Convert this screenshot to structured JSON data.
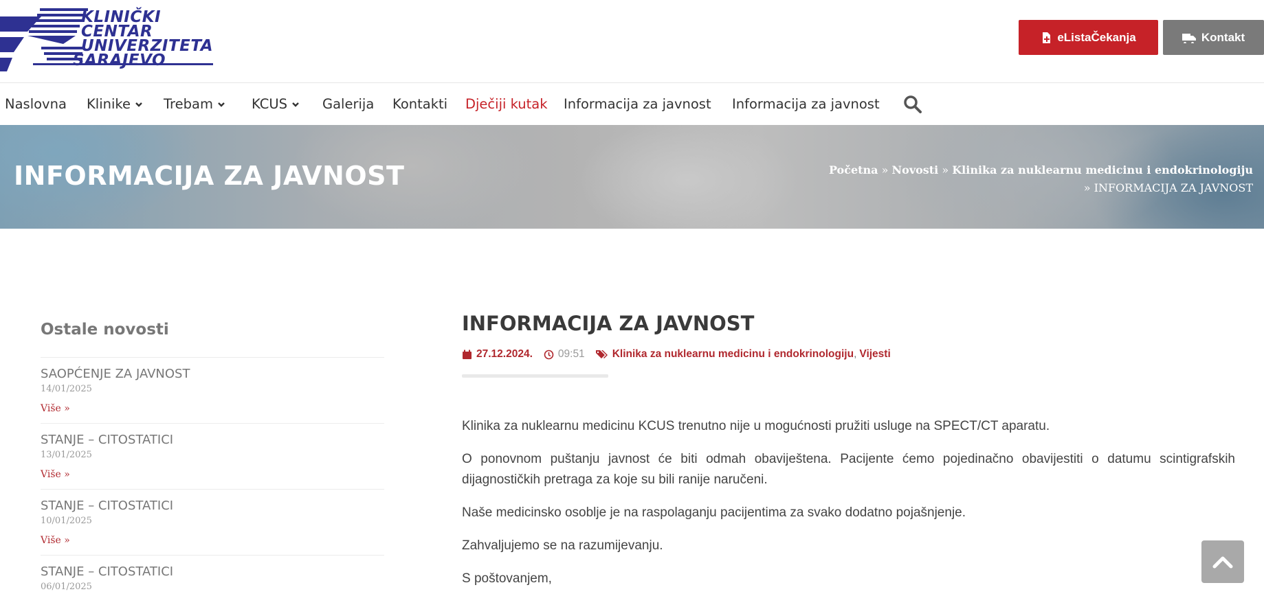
{
  "header": {
    "logo_lines": [
      "KLINIČKI",
      "CENTAR",
      "UNIVERZITETA",
      "SARAJEVO"
    ],
    "buttons": [
      {
        "label": "eListaČekanja",
        "icon": "file-plus-icon",
        "color": "#c62228"
      },
      {
        "label": "Kontakt",
        "icon": "ambulance-icon",
        "color": "#7a7a7a"
      }
    ],
    "brand_color": "#2e3192"
  },
  "nav": {
    "items": [
      {
        "label": "Naslovna"
      },
      {
        "label": "Klinike",
        "dropdown": true
      },
      {
        "label": "Trebam",
        "dropdown": true
      },
      {
        "label": "KCUS",
        "dropdown": true
      },
      {
        "label": "Galerija"
      },
      {
        "label": "Kontakti"
      },
      {
        "label": "Dječiji kutak",
        "highlight": "#c62228"
      },
      {
        "label": "Informacija za javnost"
      },
      {
        "label": "Informacija za javnost"
      }
    ],
    "search_icon": "search-icon"
  },
  "hero": {
    "title": "INFORMACIJA ZA JAVNOST",
    "breadcrumb": {
      "home": "Početna",
      "news": "Novosti",
      "category": "Klinika za nuklearnu medicinu i endokrinologiju",
      "current": "INFORMACIJA ZA JAVNOST",
      "separator": "»"
    }
  },
  "sidebar": {
    "title": "Ostale novosti",
    "more_label": "Više »",
    "items": [
      {
        "title": "SAOPĆENJE ZA JAVNOST",
        "date": "14/01/2025"
      },
      {
        "title": "STANJE – CITOSTATICI",
        "date": "13/01/2025"
      },
      {
        "title": "STANJE – CITOSTATICI",
        "date": "10/01/2025"
      },
      {
        "title": "STANJE – CITOSTATICI",
        "date": "06/01/2025"
      }
    ]
  },
  "article": {
    "title": "INFORMACIJA ZA JAVNOST",
    "date": "27.12.2024.",
    "time": "09:51",
    "categories": [
      "Klinika za nuklearnu medicinu i endokrinologiju",
      "Vijesti"
    ],
    "paragraphs": [
      "Klinika za nuklearnu medicinu KCUS trenutno nije u mogućnosti pružiti usluge na SPECT/CT aparatu.",
      "O ponovnom puštanju javnost će biti odmah obaviještena. Pacijente ćemo pojedinačno obavijestiti o datumu scintigrafskih dijagnostičkih pretraga za koje su bili ranije naručeni.",
      "Naše medicinsko osoblje je na raspolaganju pacijentima za svako dodatno pojašnjenje.",
      "Zahvaljujemo se na razumijevanju.",
      "S poštovanjem,"
    ]
  },
  "scroll_top_icon": "chevron-up-icon"
}
